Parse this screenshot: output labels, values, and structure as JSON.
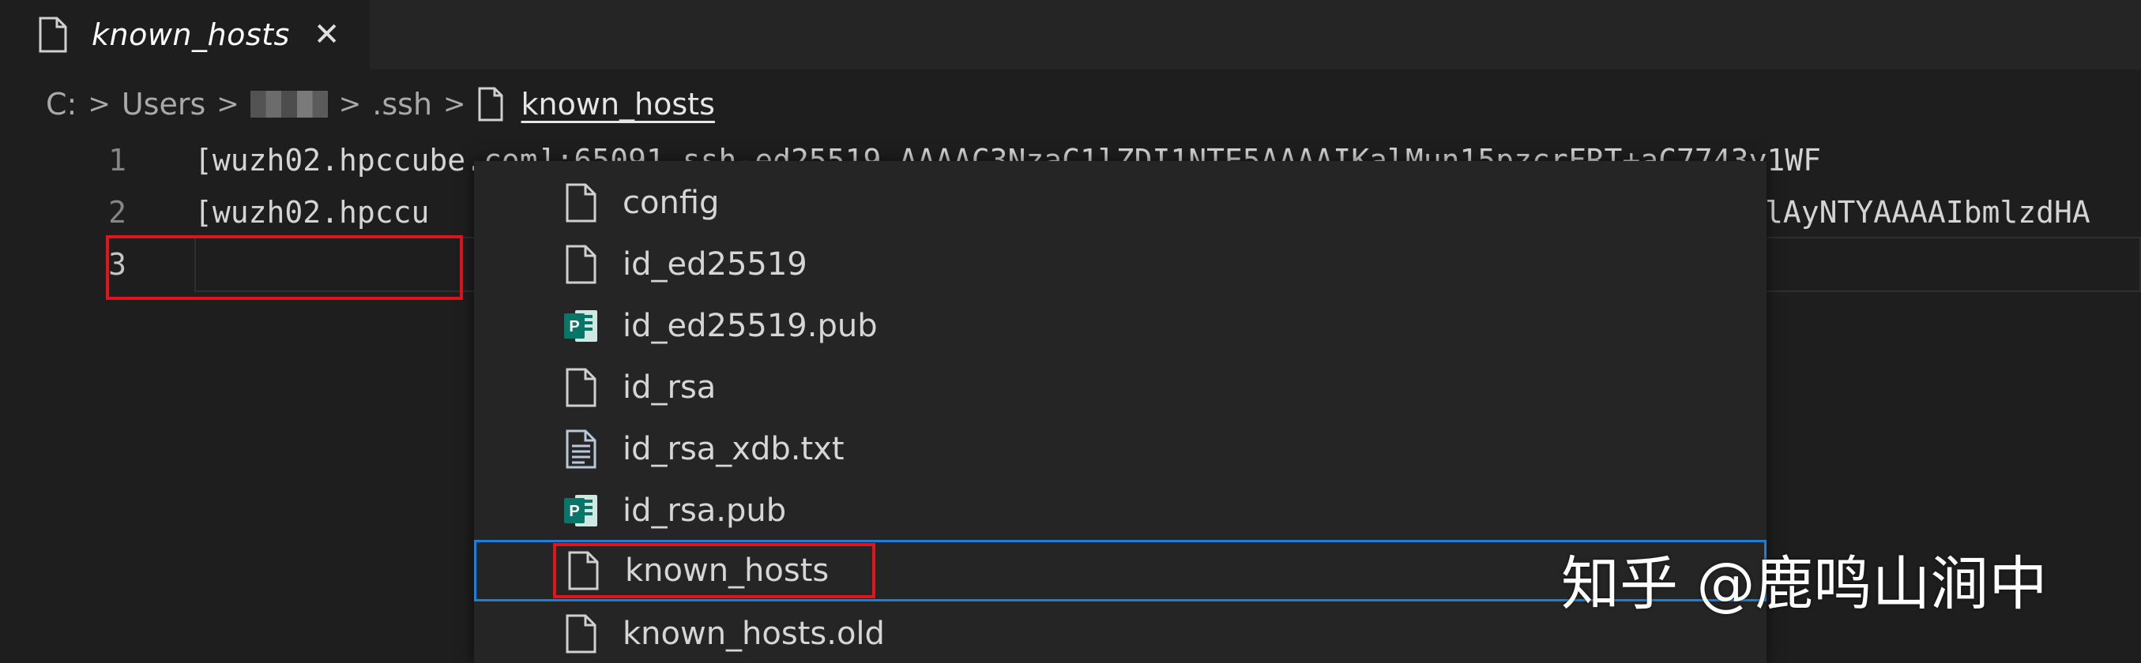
{
  "tab": {
    "title": "known_hosts",
    "close_glyph": "✕",
    "icon": "file-icon"
  },
  "breadcrumb": {
    "drive": "C:",
    "users": "Users",
    "ssh_folder": ".ssh",
    "file": "known_hosts",
    "separator": ">"
  },
  "editor": {
    "lines": [
      {
        "number": "1",
        "text": "[wuzh02.hpccube.com]:65091 ssh-ed25519 AAAAC3NzaC1lZDI1NTE5AAAAIKalMun15pzcrFRT+aC7743y1WF"
      },
      {
        "number": "2",
        "text": "[wuzh02.hpccu",
        "text_right": "lAyNTYAAAAIbmlzdHA"
      },
      {
        "number": "3",
        "text": ""
      }
    ]
  },
  "dropdown": {
    "items": [
      {
        "label": "config",
        "icon": "file-icon"
      },
      {
        "label": "id_ed25519",
        "icon": "file-icon"
      },
      {
        "label": "id_ed25519.pub",
        "icon": "publisher-icon"
      },
      {
        "label": "id_rsa",
        "icon": "file-icon"
      },
      {
        "label": "id_rsa_xdb.txt",
        "icon": "text-file-icon"
      },
      {
        "label": "id_rsa.pub",
        "icon": "publisher-icon"
      },
      {
        "label": "known_hosts",
        "icon": "file-icon",
        "selected": true
      },
      {
        "label": "known_hosts.old",
        "icon": "file-icon"
      }
    ]
  },
  "watermark": "知乎 @鹿鸣山涧中",
  "colors": {
    "editor_bg": "#1e1e1e",
    "selection_border": "#1f7fd3",
    "annotation_red": "#e0141c",
    "publisher_green": "#077568"
  }
}
